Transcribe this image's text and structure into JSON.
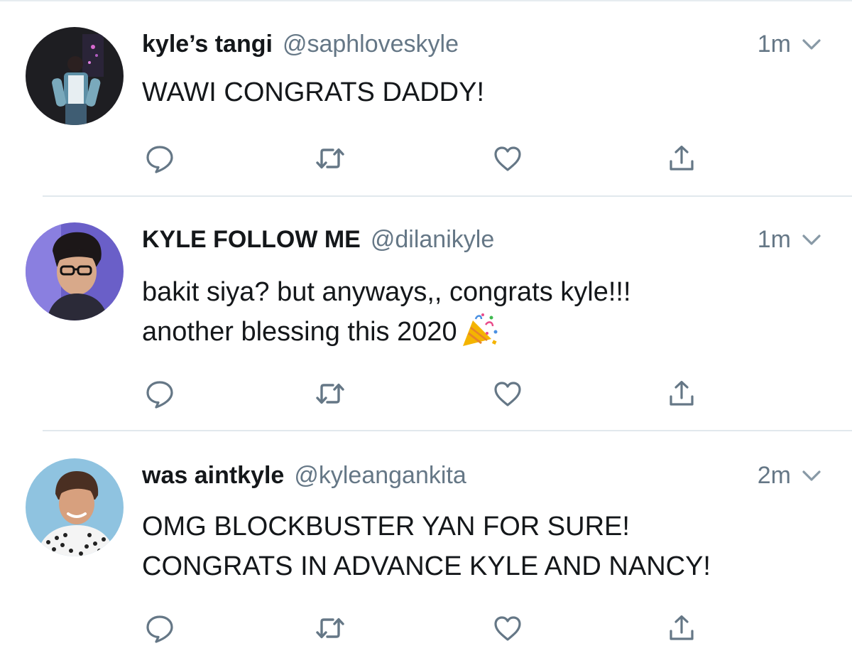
{
  "tweets": [
    {
      "display_name": "kyle’s tangi",
      "handle": "@saphloveskyle",
      "time": "1m",
      "text": "WAWI CONGRATS DADDY!",
      "emoji": ""
    },
    {
      "display_name": "KYLE FOLLOW ME",
      "handle": "@dilanikyle",
      "time": "1m",
      "text": "bakit siya? but anyways,, congrats kyle!!!\nanother blessing this 2020",
      "emoji": "party-popper-emoji"
    },
    {
      "display_name": "was aintkyle",
      "handle": "@kyleangankita",
      "time": "2m",
      "text": "OMG BLOCKBUSTER YAN FOR SURE!\nCONGRATS IN ADVANCE KYLE AND NANCY!",
      "emoji": ""
    }
  ],
  "actions": [
    "reply-icon",
    "retweet-icon",
    "like-icon",
    "share-icon"
  ],
  "colors": {
    "text": "#14171a",
    "secondary": "#657786",
    "icon": "#657786",
    "divider": "#e1e8ed"
  }
}
